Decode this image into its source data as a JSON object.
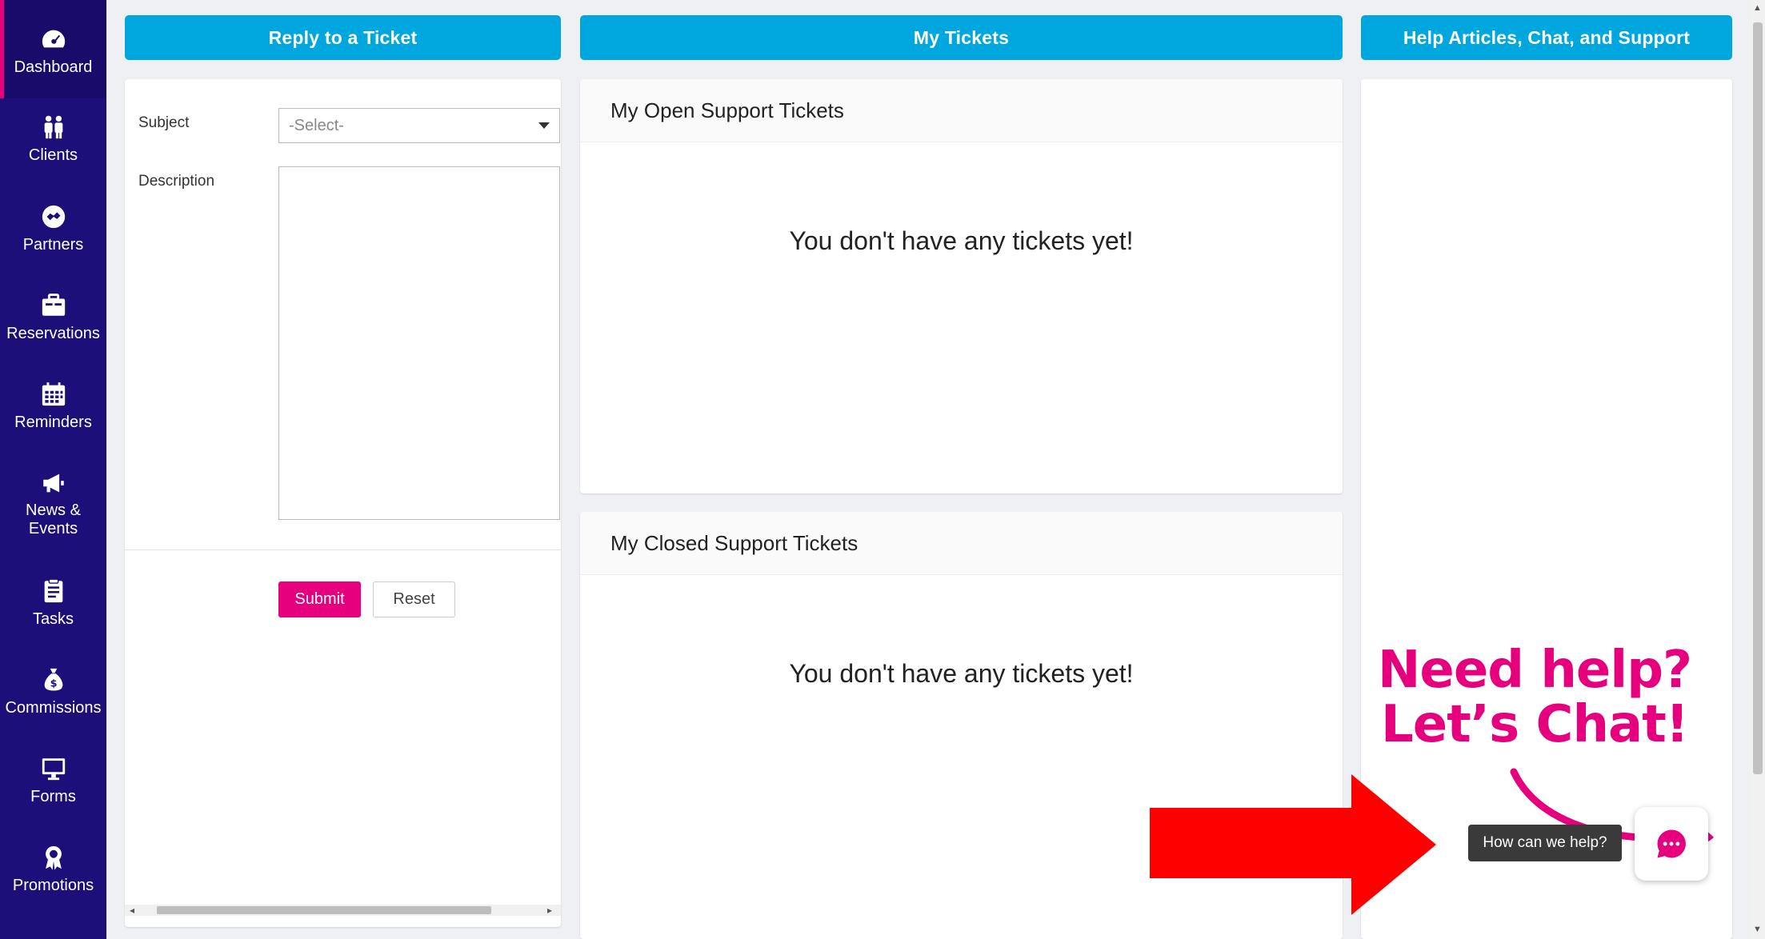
{
  "sidebar": {
    "items": [
      {
        "label": "Dashboard",
        "icon": "dashboard-icon"
      },
      {
        "label": "Clients",
        "icon": "clients-icon"
      },
      {
        "label": "Partners",
        "icon": "partners-icon"
      },
      {
        "label": "Reservations",
        "icon": "reservations-icon"
      },
      {
        "label": "Reminders",
        "icon": "calendar-icon"
      },
      {
        "label": "News &",
        "label2": "Events",
        "icon": "megaphone-icon"
      },
      {
        "label": "Tasks",
        "icon": "clipboard-icon"
      },
      {
        "label": "Commissions",
        "icon": "money-bag-icon"
      },
      {
        "label": "Forms",
        "icon": "monitor-icon"
      },
      {
        "label": "Promotions",
        "icon": "award-icon"
      }
    ]
  },
  "tabs": {
    "reply": "Reply to a Ticket",
    "my_tickets": "My Tickets",
    "help": "Help Articles, Chat, and Support"
  },
  "form": {
    "subject_label": "Subject",
    "subject_value": "-Select-",
    "description_label": "Description",
    "submit_label": "Submit",
    "reset_label": "Reset"
  },
  "tickets": {
    "open_title": "My Open Support Tickets",
    "open_empty": "You don't have any tickets yet!",
    "closed_title": "My Closed Support Tickets",
    "closed_empty": "You don't have any tickets yet!"
  },
  "chat": {
    "promo_line1": "Need help?",
    "promo_line2": "Let’s Chat!",
    "tooltip": "How can we help?"
  },
  "colors": {
    "sidebar": "#1c0f7a",
    "accent_blue": "#00a7de",
    "accent_pink": "#e6007e",
    "arrow_red": "#ff0000"
  }
}
